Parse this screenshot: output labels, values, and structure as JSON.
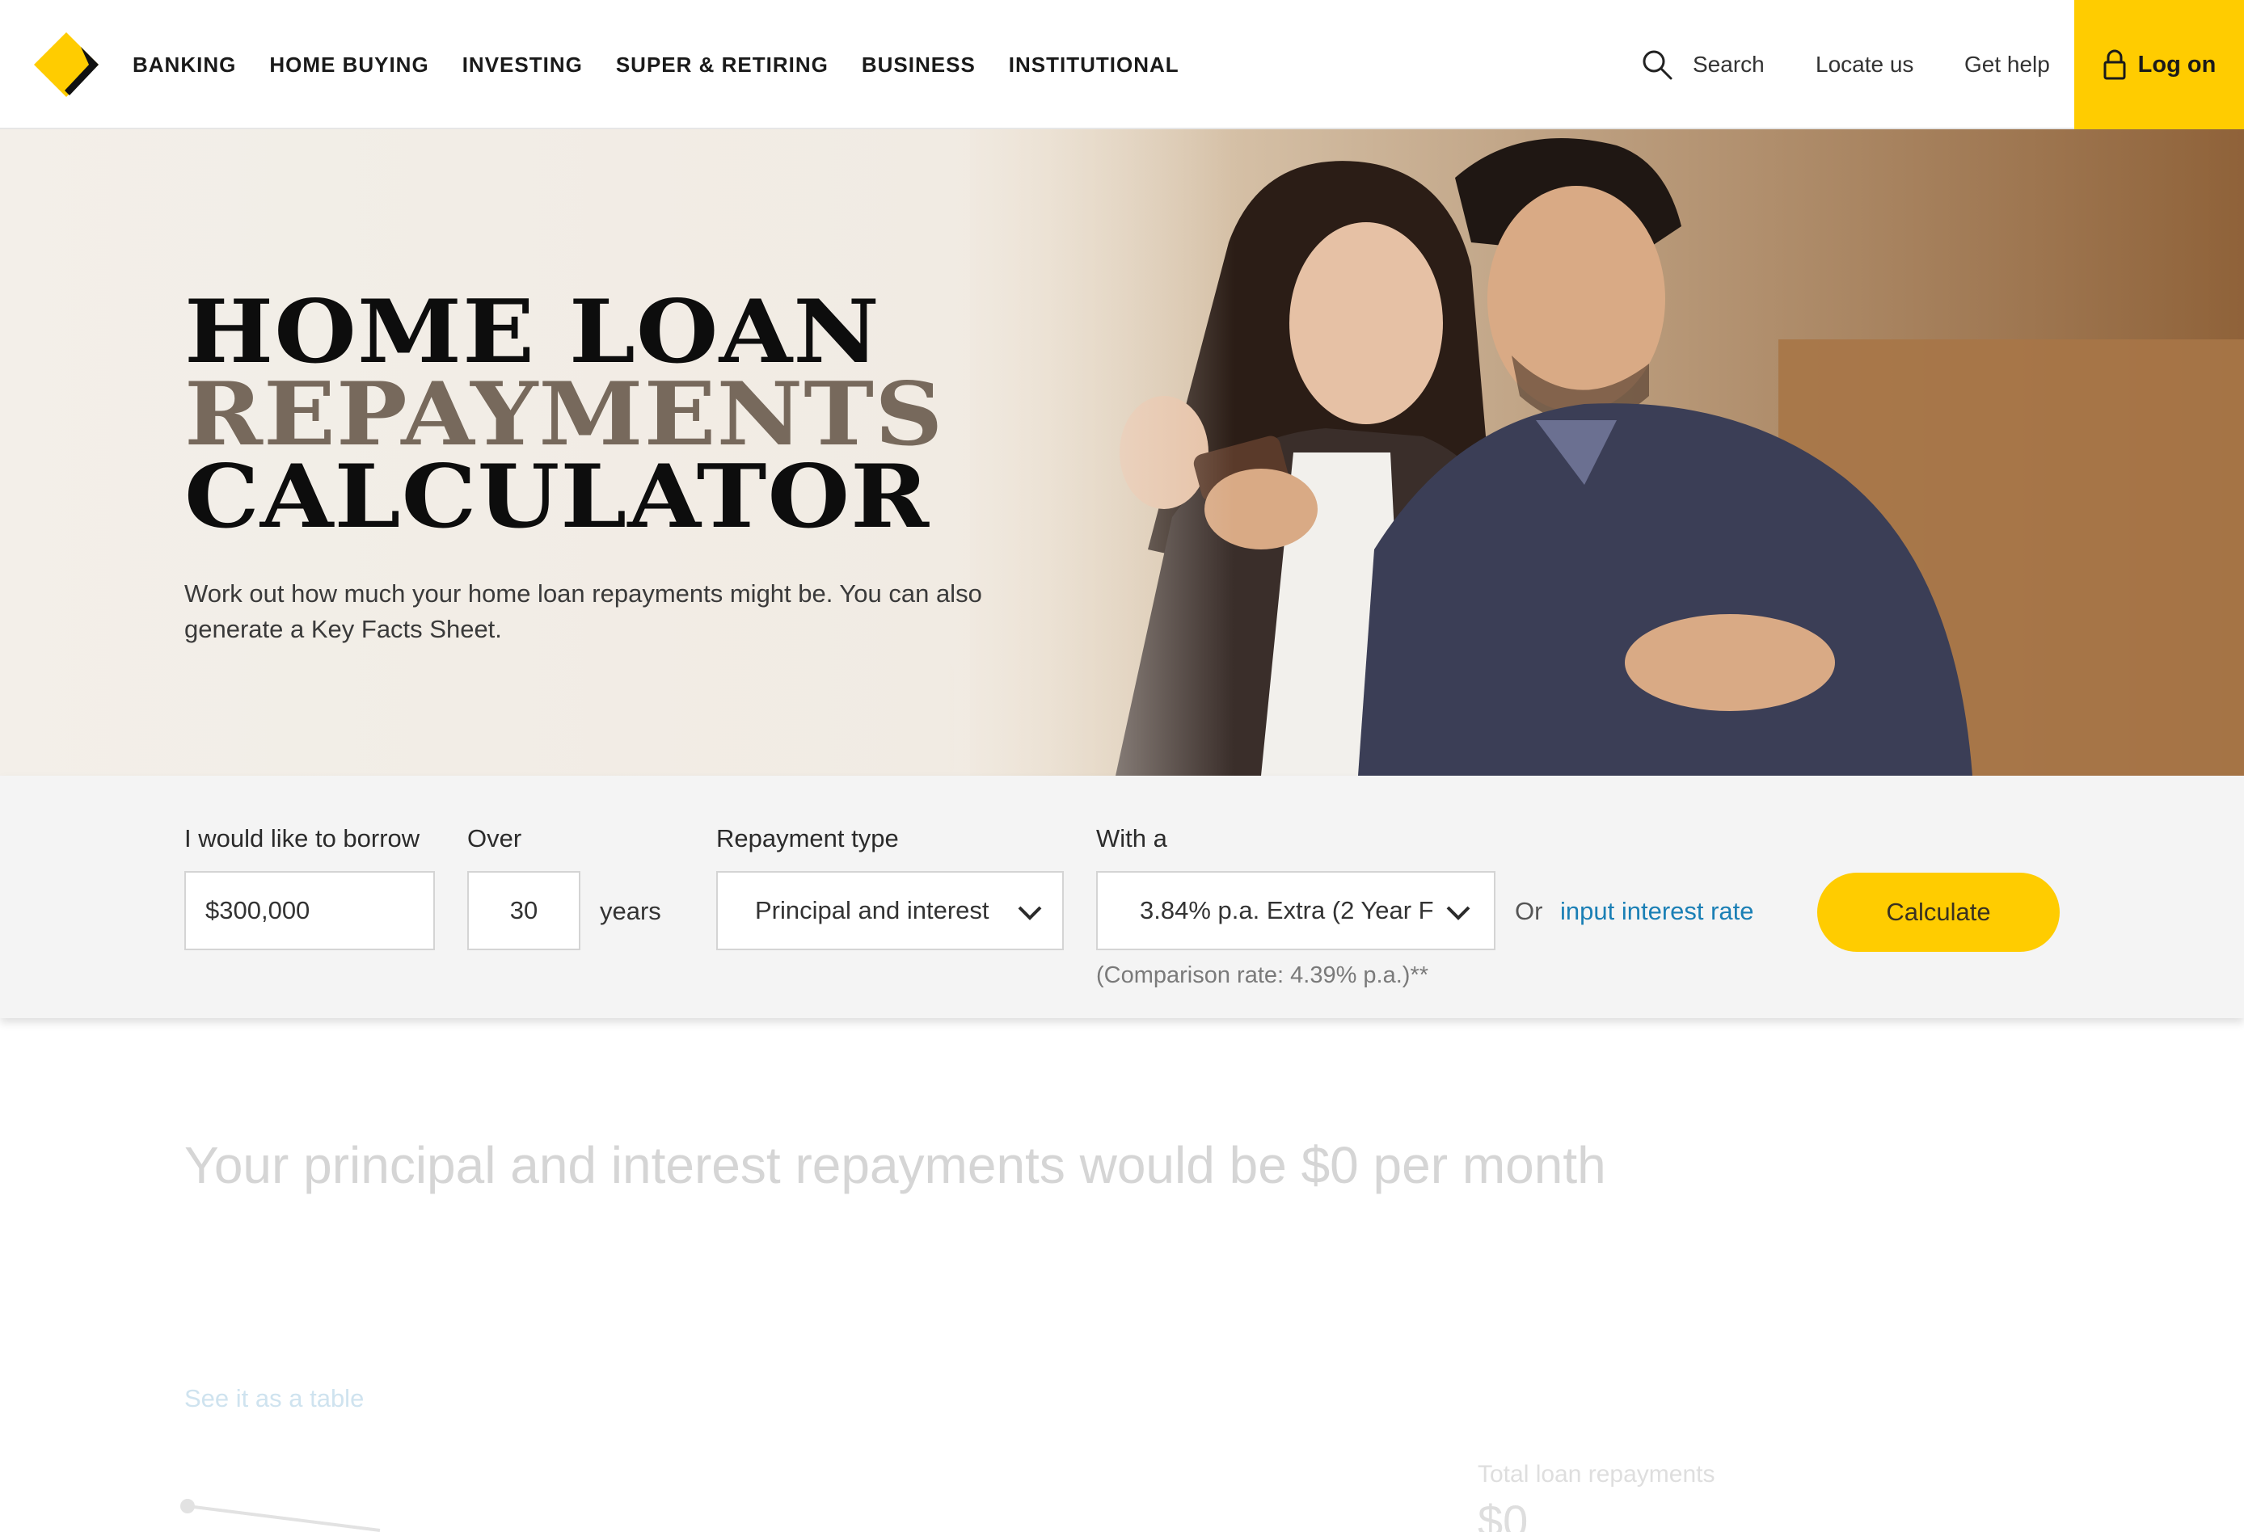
{
  "header": {
    "nav": [
      "BANKING",
      "HOME BUYING",
      "INVESTING",
      "SUPER & RETIRING",
      "BUSINESS",
      "INSTITUTIONAL"
    ],
    "search_label": "Search",
    "locate_label": "Locate us",
    "help_label": "Get help",
    "logon_label": "Log on"
  },
  "hero": {
    "title_line1": "HOME LOAN",
    "title_line2": "REPAYMENTS",
    "title_line3": "CALCULATOR",
    "subtitle": "Work out how much your home loan repayments might be. You can also generate a Key Facts Sheet."
  },
  "calculator": {
    "borrow_label": "I would like to borrow",
    "borrow_value": "$300,000",
    "over_label": "Over",
    "years_value": "30",
    "years_unit": "years",
    "repayment_label": "Repayment type",
    "repayment_value": "Principal and interest",
    "rate_label": "With a",
    "rate_value": "3.84% p.a. Extra (2 Year F",
    "or_label": "Or",
    "input_rate_link": "input interest rate",
    "calculate_label": "Calculate",
    "comparison_note": "(Comparison rate: 4.39% p.a.)**"
  },
  "results": {
    "headline": "Your principal and interest repayments would be $0 per month",
    "table_link": "See it as a table",
    "total_label": "Total loan repayments",
    "total_value": "$0"
  },
  "colors": {
    "brand_yellow": "#ffcc00",
    "link_blue": "#1a7fb5",
    "title_brown": "#77695c"
  }
}
